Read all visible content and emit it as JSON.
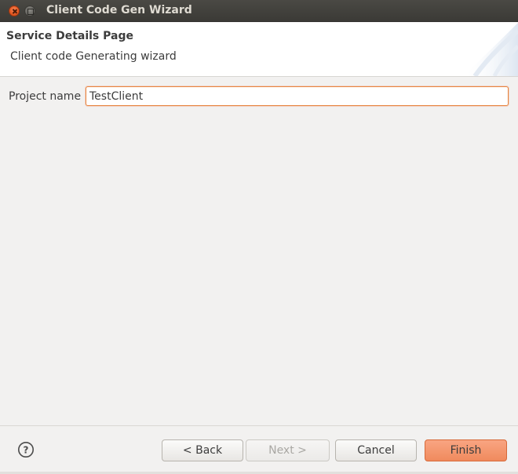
{
  "window": {
    "title": "Client Code Gen Wizard"
  },
  "header": {
    "title": "Service Details Page",
    "description": "Client code Generating wizard"
  },
  "form": {
    "project_name_label": "Project name",
    "project_name_value": "TestClient"
  },
  "buttons": {
    "back": "< Back",
    "next": "Next >",
    "cancel": "Cancel",
    "finish": "Finish"
  },
  "colors": {
    "accent": "#f08a5d",
    "titlebar": "#3c3b37",
    "focus_border": "#e7853f"
  },
  "icons": {
    "help": "help-icon",
    "close": "close-icon",
    "maximize": "maximize-icon"
  }
}
